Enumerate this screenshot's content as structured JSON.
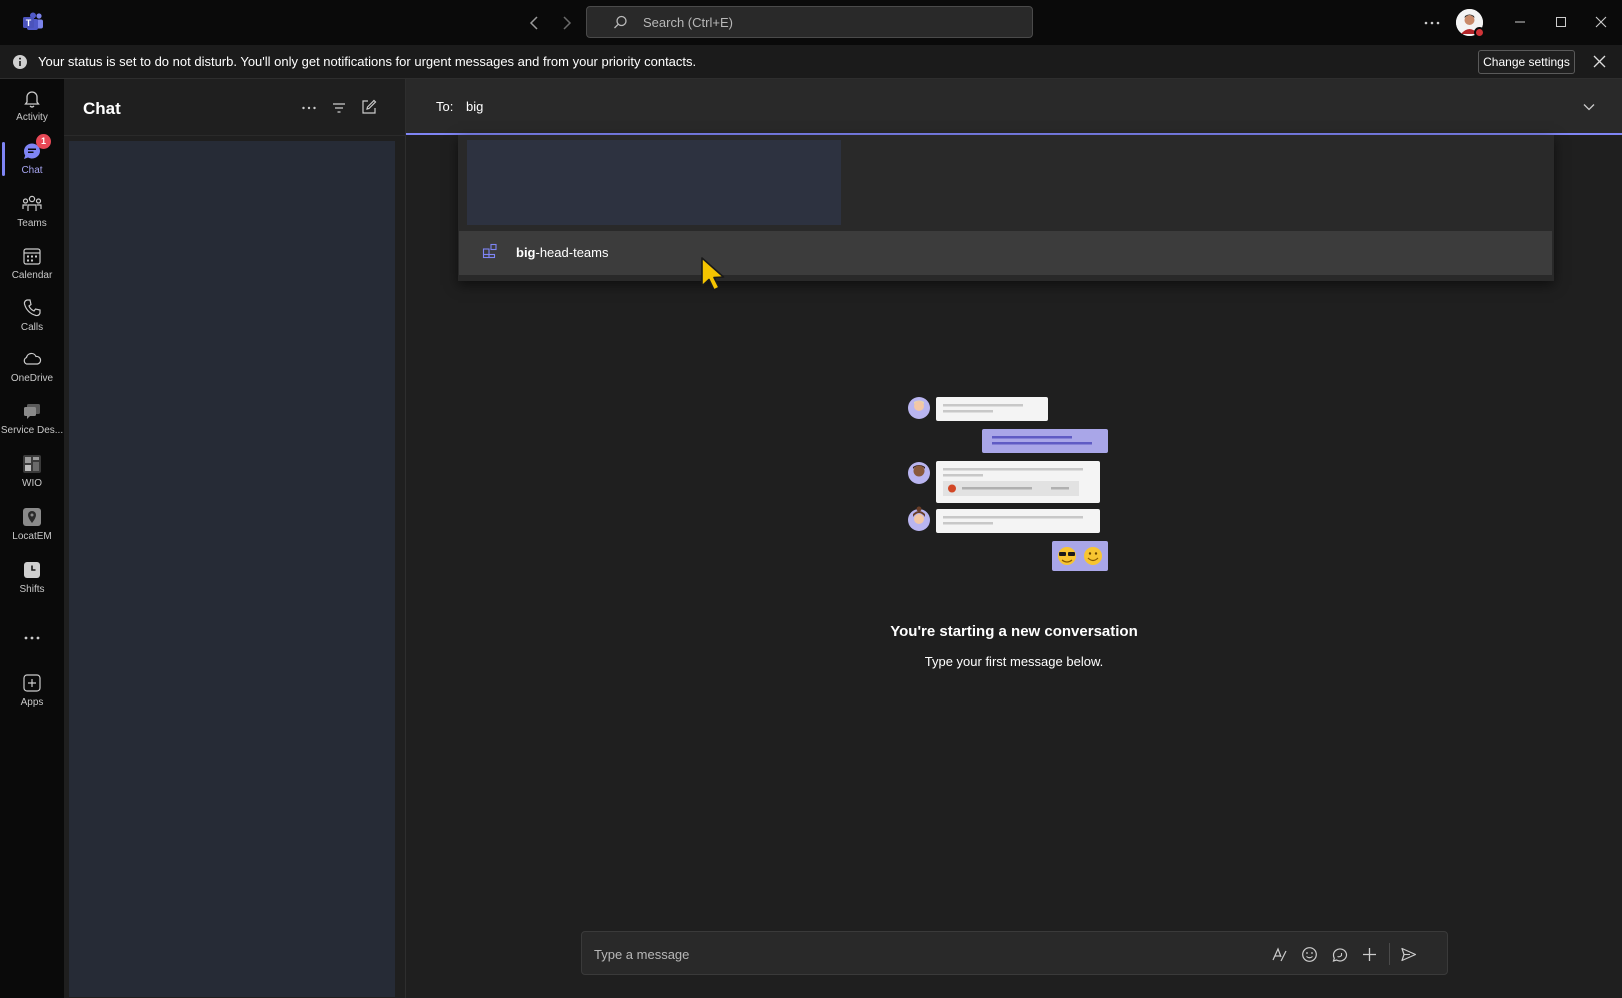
{
  "titlebar": {
    "search_placeholder": "Search (Ctrl+E)"
  },
  "banner": {
    "message": "Your status is set to do not disturb. You'll only get notifications for urgent messages and from your priority contacts.",
    "change_settings_label": "Change settings"
  },
  "rail": {
    "items": [
      {
        "label": "Activity",
        "icon": "bell-icon"
      },
      {
        "label": "Chat",
        "icon": "chat-icon",
        "badge": "1",
        "active": true
      },
      {
        "label": "Teams",
        "icon": "teams-icon"
      },
      {
        "label": "Calendar",
        "icon": "calendar-icon"
      },
      {
        "label": "Calls",
        "icon": "phone-icon"
      },
      {
        "label": "OneDrive",
        "icon": "cloud-icon"
      },
      {
        "label": "Service Des...",
        "icon": "service-desk-icon"
      },
      {
        "label": "WIO",
        "icon": "wio-icon"
      },
      {
        "label": "LocatEM",
        "icon": "location-icon"
      },
      {
        "label": "Shifts",
        "icon": "clock-icon"
      },
      {
        "label": "Apps",
        "icon": "add-app-icon"
      }
    ]
  },
  "chat_panel": {
    "title": "Chat"
  },
  "compose": {
    "to_label": "To:",
    "to_value": "big",
    "suggestion": {
      "match": "big",
      "rest": "-head-teams"
    },
    "empty_title": "You're starting a new conversation",
    "empty_subtitle": "Type your first message below.",
    "message_placeholder": "Type a message"
  },
  "colors": {
    "accent": "#7f85f5",
    "dnd": "#d13438",
    "badge": "#e74856"
  }
}
